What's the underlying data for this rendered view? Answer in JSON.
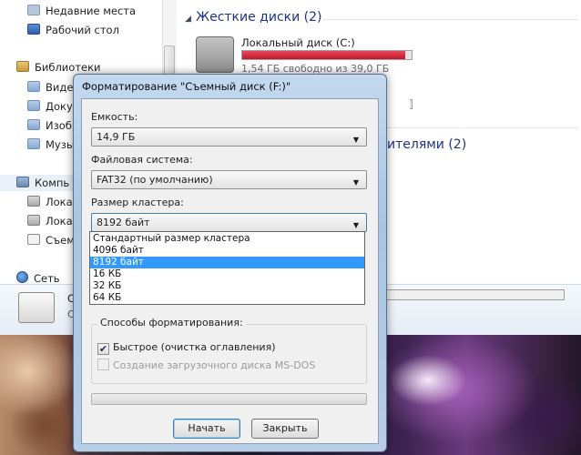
{
  "explorer": {
    "nav": {
      "recent": "Недавние места",
      "desktop": "Рабочий стол",
      "libraries": "Библиотеки",
      "lib_items": [
        "Видео",
        "Докум",
        "Изобр",
        "Музы"
      ],
      "computer": "Компь",
      "drives": [
        "Локал",
        "Локал",
        "Съемн"
      ],
      "network": "Сеть"
    },
    "content": {
      "hard_drives_group": "Жесткие диски (2)",
      "disk_name": "Локальный диск (C:)",
      "disk_used_fraction": 0.96,
      "disk_free": "1,54 ГБ свободно из 39,0 ГБ",
      "removable_group_suffix": "ителями (2)"
    },
    "details": {
      "name_fragment": "С",
      "sub_fragment": "С"
    }
  },
  "dialog": {
    "title": "Форматирование \"Съемный диск (F:)\"",
    "capacity_label": "Емкость:",
    "capacity_value": "14,9 ГБ",
    "filesystem_label": "Файловая система:",
    "filesystem_value": "FAT32 (по умолчанию)",
    "cluster_label": "Размер кластера:",
    "cluster_value": "8192 байт",
    "cluster_options": [
      "Стандартный размер кластера",
      "4096 байт",
      "8192 байт",
      "16 КБ",
      "32 КБ",
      "64 КБ"
    ],
    "selected_option_index": 2,
    "methods_label": "Способы форматирования:",
    "quick_format_label": "Быстрое (очистка оглавления)",
    "msdos_label": "Создание загрузочного диска MS-DOS",
    "start_button": "Начать",
    "close_button": "Закрыть",
    "arrow_glyph": "▼",
    "check_glyph": "✔"
  }
}
